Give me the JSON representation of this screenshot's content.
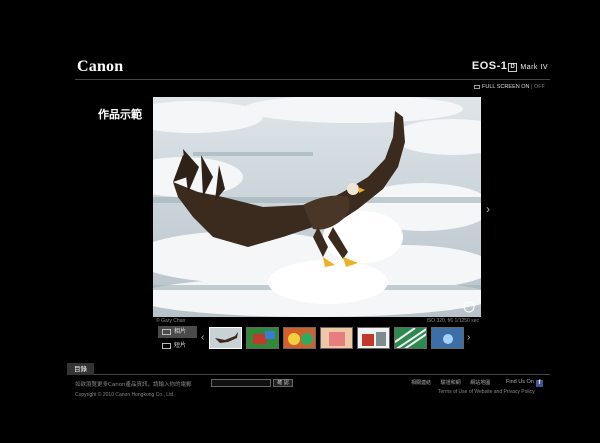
{
  "header": {
    "brand": "Canon",
    "model_main": "EOS-1",
    "model_d": "D",
    "model_mark": "Mark IV"
  },
  "fullscreen": {
    "on_label": "FULL SCREEN ON",
    "separator": "|",
    "off_label": "OFF"
  },
  "gallery": {
    "title": "作品示範",
    "credit": "© Gary Chan",
    "exif": "ISO 320, f/6   1/1250 sec"
  },
  "media_type": {
    "photo_label": "相片",
    "video_label": "短片"
  },
  "tabs": {
    "catalog": "目錄"
  },
  "footer": {
    "info_line": "如欲瀏覽更多Canon產品資訊，請輸入你的電郵",
    "copyright": "Copyright © 2010 Canon Hongkong Co., Ltd.",
    "submit_label": "確 認",
    "links": [
      "相關連結",
      "驗證和網",
      "網站地圖"
    ],
    "find_us": "Find Us On",
    "terms": "Terms of Use of Website and Privacy Policy"
  },
  "colors": {
    "background": "#000000",
    "facebook": "#3b5998"
  }
}
